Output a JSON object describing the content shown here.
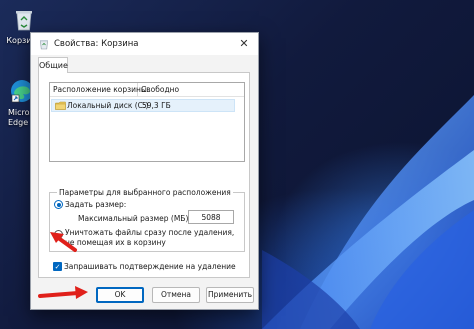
{
  "desktop": {
    "icons": [
      {
        "label": "Корзина",
        "icon": "recycle-bin-icon"
      },
      {
        "label": "Micros\nEdge",
        "icon": "edge-icon"
      }
    ]
  },
  "dialog": {
    "title": "Свойства: Корзина",
    "title_icon": "recycle-bin-icon",
    "close_glyph": "✕",
    "tab_general": "Общие",
    "list": {
      "columns": [
        "Расположение корзины",
        "Свободно"
      ],
      "rows": [
        {
          "location": "Локальный диск (C:)",
          "free": "59,3 ГБ",
          "icon": "drive-icon"
        }
      ]
    },
    "params": {
      "legend": "Параметры для выбранного расположения",
      "set_size_label": "Задать размер:",
      "max_size_label": "Максимальный размер (МБ):",
      "max_size_value": "5088",
      "delete_label": "Уничтожать файлы сразу после удаления, не помещая их в корзину",
      "selected": "set_size"
    },
    "confirm_label": "Запрашивать подтверждение на удаление",
    "confirm_checked": true,
    "buttons": {
      "ok": "OK",
      "cancel": "Отмена",
      "apply": "Применить"
    }
  },
  "colors": {
    "accent": "#0067c0",
    "annotation_arrow": "#e0201a"
  }
}
